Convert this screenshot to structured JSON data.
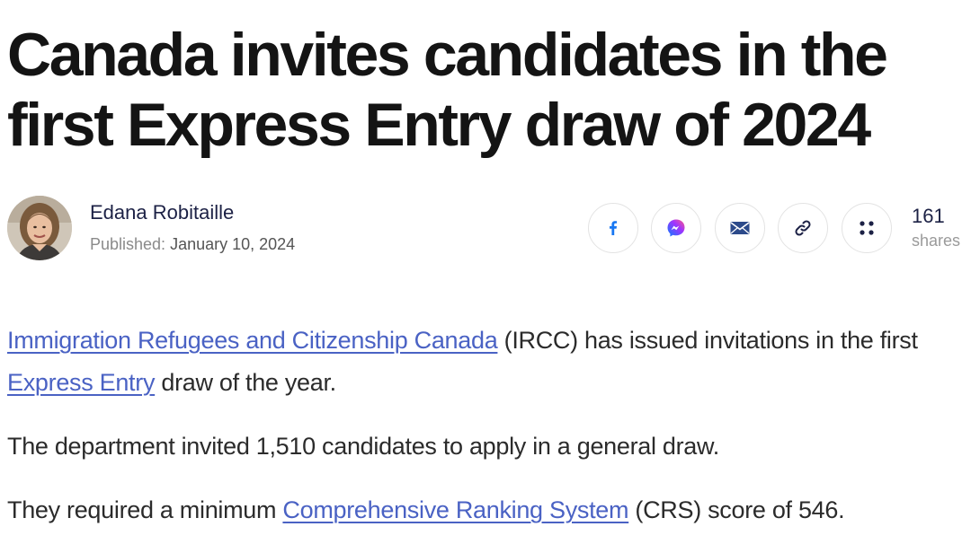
{
  "article": {
    "headline": "Canada invites candidates in the first Express Entry draw of 2024",
    "author": {
      "name": "Edana Robitaille",
      "published_label": "Published:",
      "published_date": "January 10, 2024"
    },
    "share": {
      "buttons": [
        {
          "name": "facebook",
          "icon": "facebook-icon",
          "color": "#1877f2"
        },
        {
          "name": "messenger",
          "icon": "messenger-icon",
          "color": "#a033ff"
        },
        {
          "name": "email",
          "icon": "envelope-icon",
          "color": "#2c4a8a"
        },
        {
          "name": "copy-link",
          "icon": "link-icon",
          "color": "#1c2145"
        },
        {
          "name": "more",
          "icon": "more-dots-icon",
          "color": "#1c2145"
        }
      ],
      "count": "161",
      "count_label": "shares"
    },
    "body": {
      "p1": {
        "link1": "Immigration Refugees and Citizenship Canada",
        "text1": " (IRCC) has issued invitations in the first ",
        "link2": "Express Entry",
        "text2": " draw of the year."
      },
      "p2": {
        "text": "The department invited 1,510 candidates to apply in a general draw."
      },
      "p3": {
        "text1": "They required a minimum ",
        "link": "Comprehensive Ranking System",
        "text2": " (CRS) score of 546."
      }
    },
    "colors": {
      "link": "#4a62c4",
      "heading": "#141414",
      "author": "#1c2145"
    }
  }
}
